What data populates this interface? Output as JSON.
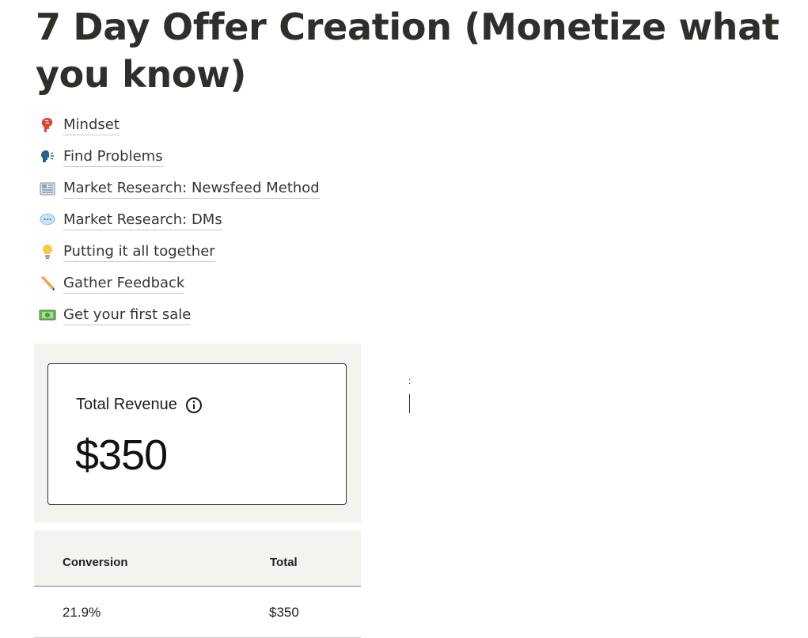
{
  "page": {
    "title": "7 Day Offer Creation (Monetize what you know)"
  },
  "links": [
    {
      "label": "Mindset",
      "icon": "brain-head-icon"
    },
    {
      "label": "Find Problems",
      "icon": "speaking-head-icon"
    },
    {
      "label": "Market Research: Newsfeed Method",
      "icon": "newspaper-icon"
    },
    {
      "label": "Market Research: DMs",
      "icon": "speech-bubble-icon"
    },
    {
      "label": "Putting it all together",
      "icon": "lightbulb-icon"
    },
    {
      "label": "Gather Feedback",
      "icon": "pencil-icon"
    },
    {
      "label": "Get your first sale",
      "icon": "dollar-bill-icon"
    }
  ],
  "revenue": {
    "label": "Total Revenue",
    "value": "$350"
  },
  "table": {
    "headers": [
      "Conversion",
      "Total"
    ],
    "rows": [
      [
        "21.9%",
        "$350"
      ]
    ]
  },
  "misc": {
    "colon": ":"
  },
  "colors": {
    "text": "#37352f",
    "panel_bg": "#f3f3ef"
  }
}
